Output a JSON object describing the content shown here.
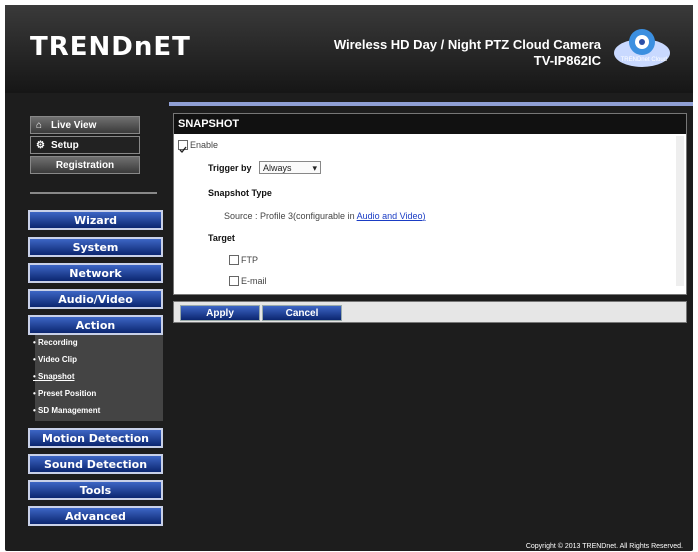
{
  "header": {
    "logo": "TRENDnET",
    "product_title": "Wireless HD Day / Night PTZ Cloud Camera",
    "model": "TV-IP862IC",
    "cloud_label": "TRENDnet Cloud"
  },
  "left_nav": {
    "live_view": "Live View",
    "setup": "Setup",
    "registration": "Registration",
    "menu": [
      "Wizard",
      "System",
      "Network",
      "Audio/Video",
      "Action"
    ],
    "action_sub": [
      "Recording",
      "Video Clip",
      "Snapshot",
      "Preset Position",
      "SD Management"
    ],
    "bottom_menu": [
      "Motion Detection",
      "Sound Detection",
      "Tools",
      "Advanced"
    ]
  },
  "panel": {
    "title": "SNAPSHOT",
    "enable_label": "Enable",
    "trigger_label": "Trigger by",
    "trigger_value": "Always",
    "snapshot_type_label": "Snapshot Type",
    "source_text": "Source : Profile 3(configurable in",
    "source_link": "Audio and Video",
    "source_close": ")",
    "target_label": "Target",
    "ftp_label": "FTP",
    "email_label": "E-mail"
  },
  "buttons": {
    "apply": "Apply",
    "cancel": "Cancel"
  },
  "footer": {
    "copyright": "Copyright © 2013 TRENDnet. All Rights Reserved."
  }
}
